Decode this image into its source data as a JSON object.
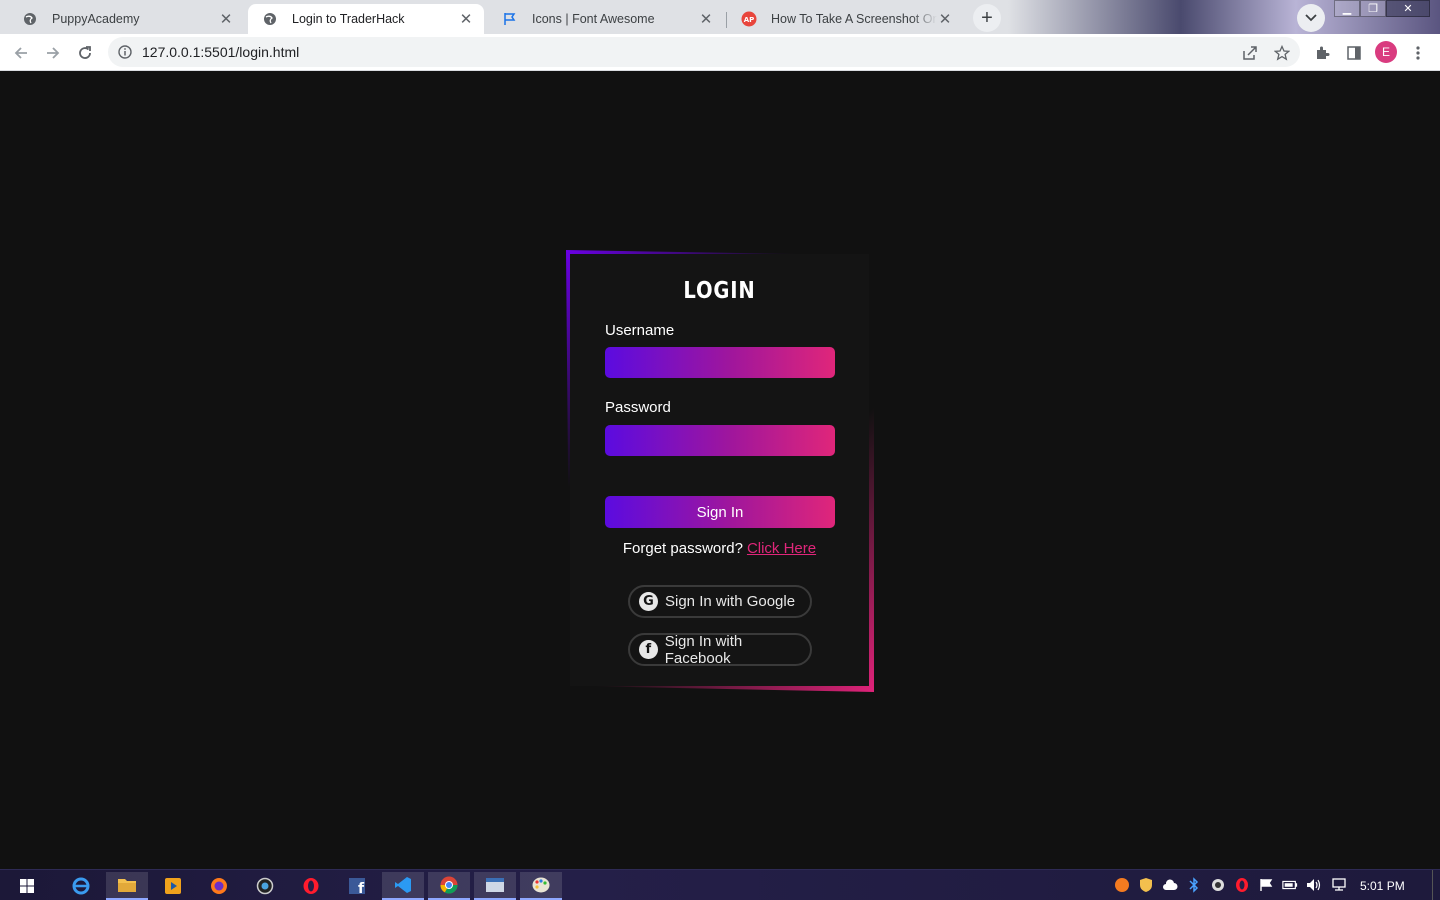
{
  "browser": {
    "tabs": [
      {
        "title": "PuppyAcademy",
        "active": false,
        "icon": "globe-icon"
      },
      {
        "title": "Login to TraderHack",
        "active": true,
        "icon": "globe-icon"
      },
      {
        "title": "Icons | Font Awesome",
        "active": false,
        "icon": "flag-icon"
      },
      {
        "title": "How To Take A Screenshot On An",
        "active": false,
        "icon": "site-logo-icon"
      }
    ],
    "url": "127.0.0.1:5501/login.html",
    "profile_initial": "E"
  },
  "login": {
    "title": "LOGIN",
    "username_label": "Username",
    "username_value": "",
    "password_label": "Password",
    "password_value": "",
    "signin_label": "Sign In",
    "forgot_text": "Forget password?",
    "forgot_link": "Click Here",
    "google_label": "Sign In with Google",
    "facebook_label": "Sign In with Facebook",
    "gradient_colors": [
      "#5b0be0",
      "#e0267a"
    ]
  },
  "taskbar": {
    "apps": [
      "windows-start-icon",
      "internet-explorer-icon",
      "file-explorer-icon",
      "media-player-icon",
      "firefox-icon",
      "camera-icon",
      "opera-icon",
      "facebook-icon",
      "vscode-icon",
      "chrome-icon",
      "window-app-icon",
      "paint-icon"
    ],
    "tray": [
      "avast-icon",
      "shield-icon",
      "cloud-icon",
      "bluetooth-icon",
      "camera-tray-icon",
      "opera-tray-icon",
      "flag-tray-icon",
      "battery-icon",
      "volume-icon",
      "network-icon"
    ],
    "clock": "5:01 PM"
  }
}
